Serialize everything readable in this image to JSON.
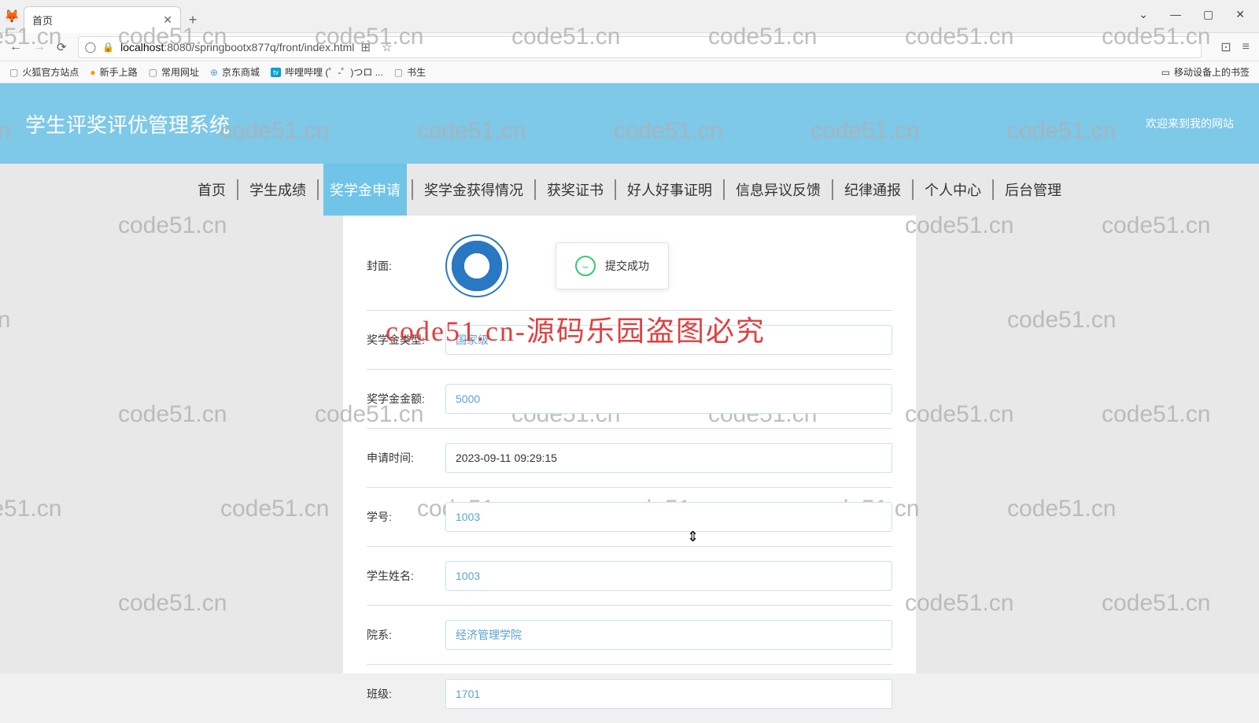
{
  "browser": {
    "tab_title": "首页",
    "url_host": "localhost",
    "url_port": ":8080",
    "url_path": "/springbootx877q/front/index.html",
    "bookmarks": [
      "火狐官方站点",
      "新手上路",
      "常用网址",
      "京东商城",
      "哔哩哔哩 (゜-゜)つロ ...",
      "书生"
    ],
    "mobile_bm": "移动设备上的书签"
  },
  "header": {
    "system_title": "学生评奖评优管理系统",
    "welcome": "欢迎来到我的网站"
  },
  "nav": {
    "items": [
      "首页",
      "学生成绩",
      "奖学金申请",
      "奖学金获得情况",
      "获奖证书",
      "好人好事证明",
      "信息异议反馈",
      "纪律通报",
      "个人中心",
      "后台管理"
    ],
    "active_index": 2
  },
  "form": {
    "cover_label": "封面:",
    "toast_text": "提交成功",
    "type_label": "奖学金类型:",
    "type_value": "国家级",
    "amount_label": "奖学金金额:",
    "amount_value": "5000",
    "time_label": "申请时间:",
    "time_value": "2023-09-11 09:29:15",
    "sid_label": "学号:",
    "sid_value": "1003",
    "sname_label": "学生姓名:",
    "sname_value": "1003",
    "dept_label": "院系:",
    "dept_value": "经济管理学院",
    "class_label": "班级:",
    "class_value": "1701"
  },
  "watermark_text": "code51.cn",
  "red_overlay": "code51.cn-源码乐园盗图必究"
}
